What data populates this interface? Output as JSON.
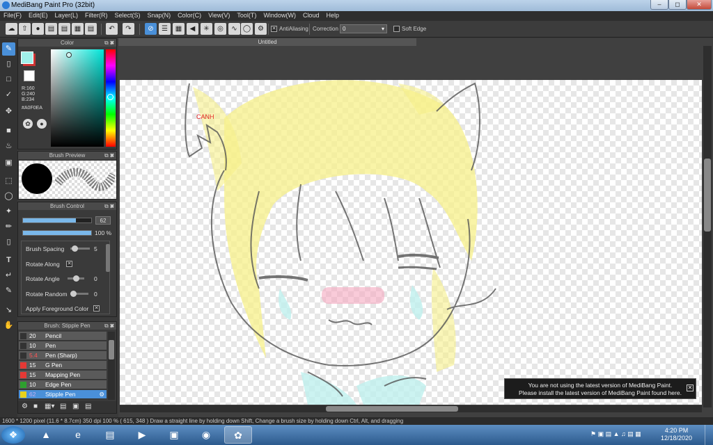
{
  "window": {
    "title": "MediBang Paint Pro (32bit)"
  },
  "menu": [
    "File(F)",
    "Edit(E)",
    "Layer(L)",
    "Filter(R)",
    "Select(S)",
    "Snap(N)",
    "Color(C)",
    "View(V)",
    "Tool(T)",
    "Window(W)",
    "Cloud",
    "Help"
  ],
  "toolbar": {
    "antialiasing_label": "AntiAliasing",
    "correction_label": "Correction",
    "correction_value": "0",
    "soft_edge_label": "Soft Edge"
  },
  "color_panel": {
    "title": "Color",
    "r": "R:160",
    "g": "G:240",
    "b": "B:234",
    "hex": "#A0F0EA",
    "foreground": "#a0f0ea",
    "background": "#ffffff"
  },
  "brush_preview": {
    "title": "Brush Preview"
  },
  "brush_control": {
    "title": "Brush Control",
    "size_value": "62",
    "opacity_value": "100 %",
    "size_fraction": 0.78,
    "opacity_fraction": 1.0,
    "rows": [
      {
        "label": "Brush Spacing",
        "value": "5"
      },
      {
        "label": "Rotate Along",
        "value": ""
      },
      {
        "label": "Rotate Angle",
        "value": "0"
      },
      {
        "label": "Rotate Random",
        "value": "0"
      },
      {
        "label": "Apply Foreground Color",
        "value": ""
      }
    ]
  },
  "brush_list": {
    "title": "Brush: Stipple Pen",
    "items": [
      {
        "size": "20",
        "name": "Pencil",
        "color": "#333333"
      },
      {
        "size": "10",
        "name": "Pen",
        "color": "#333333"
      },
      {
        "size": "5.4",
        "name": "Pen (Sharp)",
        "color": "#333333"
      },
      {
        "size": "15",
        "name": "G Pen",
        "color": "#e53935"
      },
      {
        "size": "15",
        "name": "Mapping Pen",
        "color": "#e53935"
      },
      {
        "size": "10",
        "name": "Edge Pen",
        "color": "#2ea02e"
      },
      {
        "size": "62",
        "name": "Stipple Pen",
        "color": "#e8d21c"
      }
    ]
  },
  "document": {
    "tab": "Untitled",
    "canvas_label": "CANH"
  },
  "status": {
    "text": "1600 * 1200 pixel  (11.6 * 8.7cm)  350 dpi  100 %  ( 615, 348 )  Draw a straight line by holding down Shift, Change a brush size by holding down Ctrl, Alt, and dragging"
  },
  "notice": {
    "line1": "You are not using the latest version of MediBang Paint.",
    "line2": "Please install the latest version of MediBang Paint found here."
  },
  "taskbar": {
    "time": "4:20 PM",
    "date": "12/18/2020"
  }
}
